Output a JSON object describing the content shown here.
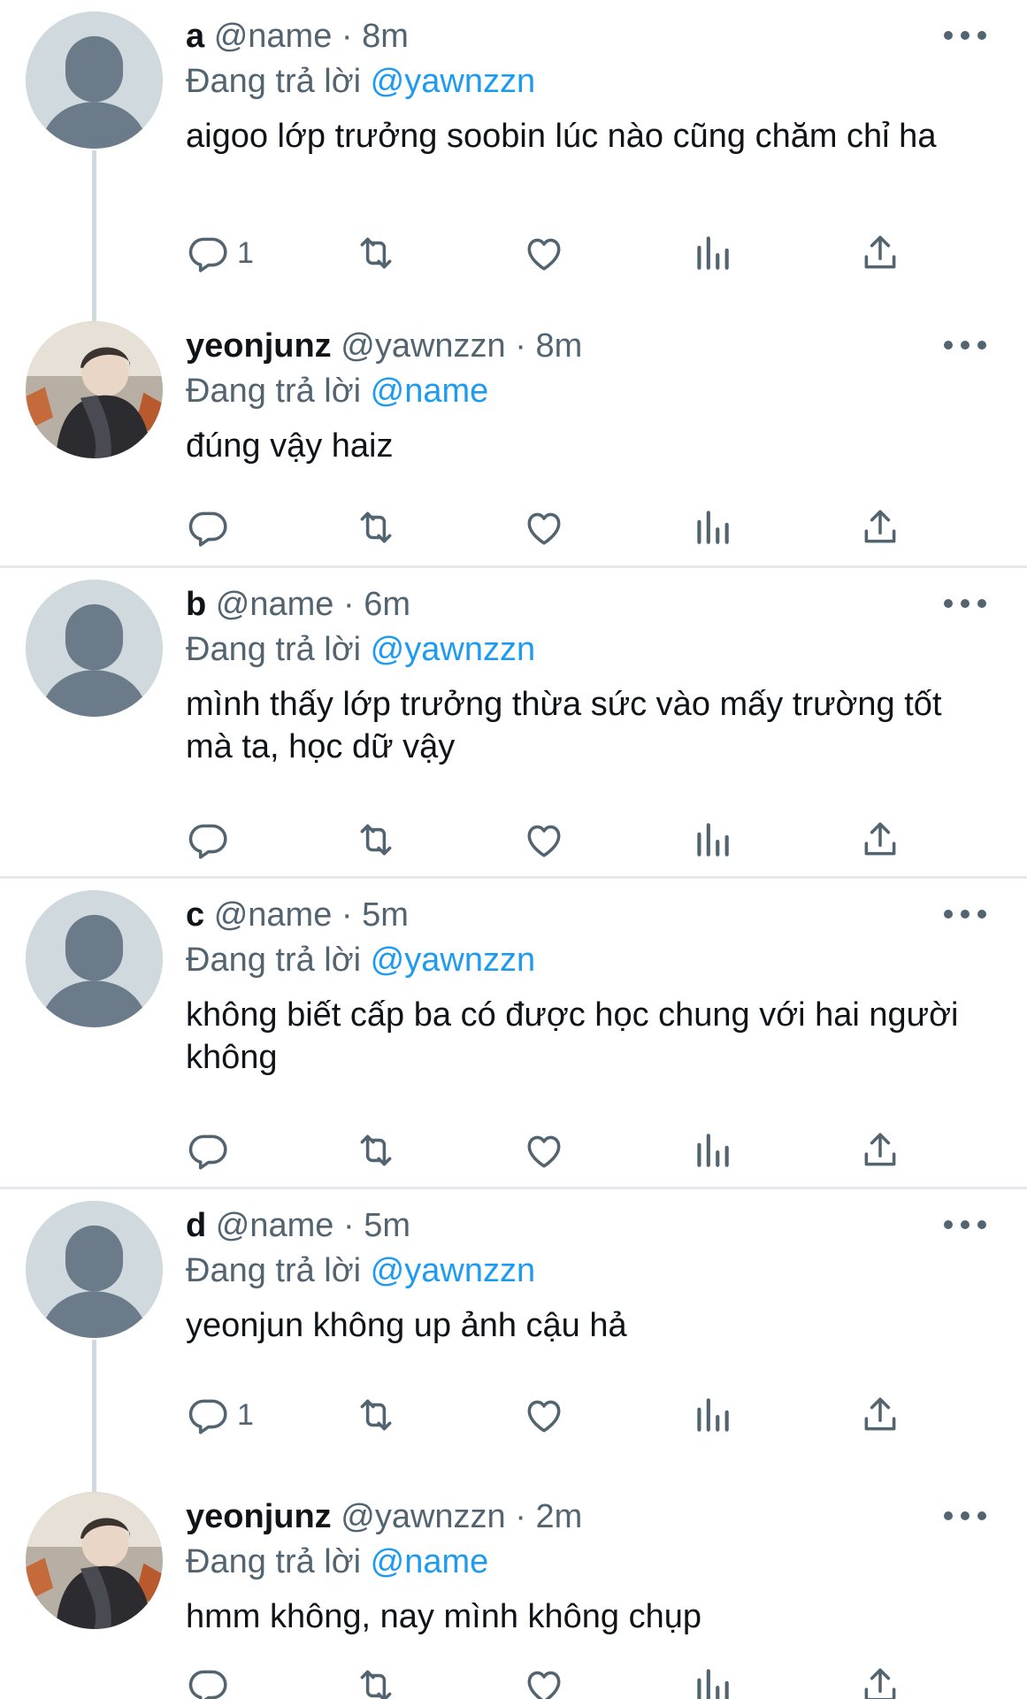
{
  "replying_label": "Đang trả lời",
  "icons": {
    "reply": "reply-icon",
    "retweet": "retweet-icon",
    "like": "heart-icon",
    "views": "analytics-icon",
    "share": "share-icon",
    "more": "more-icon"
  },
  "colors": {
    "link": "#1d9bf0",
    "secondary": "#536471",
    "divider": "#e6e9ec",
    "avatar_bg": "#cfd9de"
  },
  "tweets": [
    {
      "name": "a",
      "handle": "@name",
      "separator": "·",
      "time": "8m",
      "replying_to": "@yawnzzn",
      "text": "aigoo lớp trưởng soobin lúc nào cũng chăm chỉ ha",
      "reply_count": "1",
      "avatar": "default"
    },
    {
      "name": "yeonjunz",
      "handle": "@yawnzzn",
      "separator": "·",
      "time": "8m",
      "replying_to": "@name",
      "text": "đúng vậy haiz",
      "reply_count": "",
      "avatar": "photo"
    },
    {
      "name": "b",
      "handle": "@name",
      "separator": "·",
      "time": "6m",
      "replying_to": "@yawnzzn",
      "text": "mình thấy lớp trưởng thừa sức vào mấy trường tốt mà ta, học dữ vậy",
      "reply_count": "",
      "avatar": "default"
    },
    {
      "name": "c",
      "handle": "@name",
      "separator": "·",
      "time": "5m",
      "replying_to": "@yawnzzn",
      "text": "không biết cấp ba có được học chung với hai người không",
      "reply_count": "",
      "avatar": "default"
    },
    {
      "name": "d",
      "handle": "@name",
      "separator": "·",
      "time": "5m",
      "replying_to": "@yawnzzn",
      "text": "yeonjun không up ảnh cậu hả",
      "reply_count": "1",
      "avatar": "default"
    },
    {
      "name": "yeonjunz",
      "handle": "@yawnzzn",
      "separator": "·",
      "time": "2m",
      "replying_to": "@name",
      "text": "hmm không, nay mình không chụp",
      "reply_count": "",
      "avatar": "photo"
    }
  ]
}
